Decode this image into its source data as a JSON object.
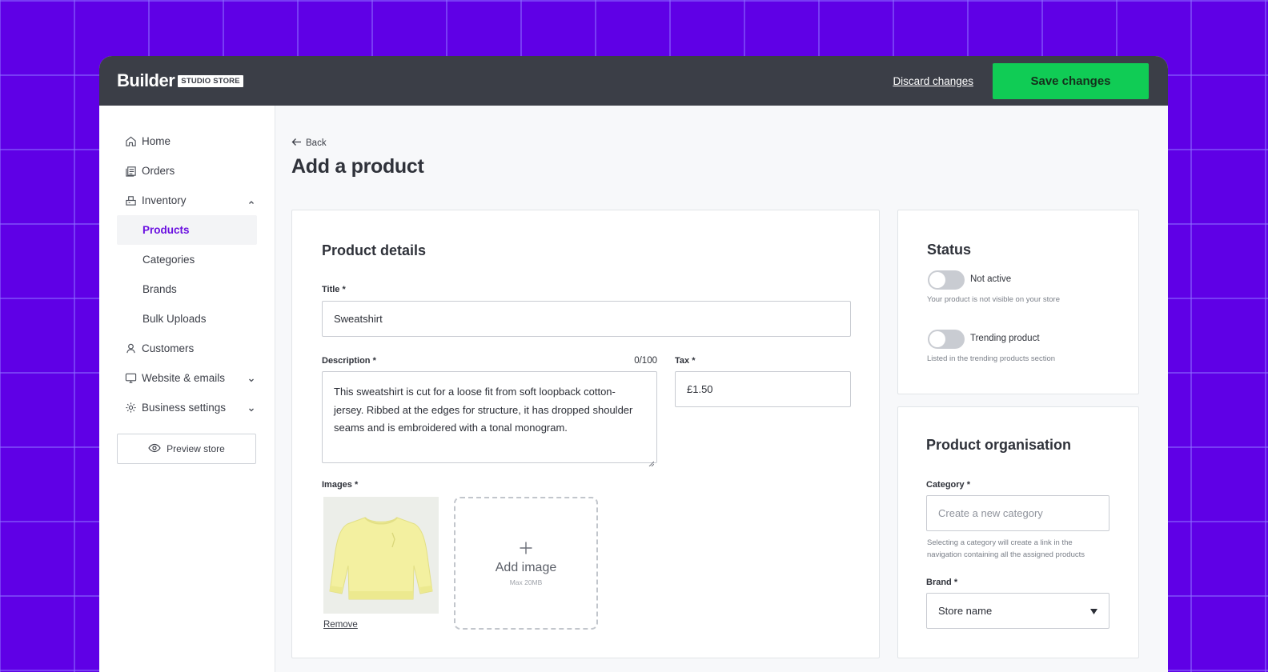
{
  "brand": {
    "logo_text": "Builder",
    "badge": "STUDIO STORE"
  },
  "topbar": {
    "discard_label": "Discard changes",
    "save_label": "Save changes"
  },
  "colors": {
    "accent": "#6a0fe0",
    "save_button": "#10cc55",
    "topbar": "#3b3e47",
    "background": "#5f00e6"
  },
  "sidebar": {
    "items": [
      {
        "label": "Home",
        "icon": "home-icon"
      },
      {
        "label": "Orders",
        "icon": "orders-icon"
      },
      {
        "label": "Inventory",
        "icon": "inventory-icon",
        "expanded": true
      },
      {
        "label": "Products",
        "active": true
      },
      {
        "label": "Categories"
      },
      {
        "label": "Brands"
      },
      {
        "label": "Bulk Uploads"
      },
      {
        "label": "Customers",
        "icon": "customers-icon"
      },
      {
        "label": "Website & emails",
        "icon": "monitor-icon",
        "expanded": false
      },
      {
        "label": "Business settings",
        "icon": "gear-icon",
        "expanded": false
      }
    ],
    "preview_label": "Preview store"
  },
  "page": {
    "back_label": "Back",
    "title": "Add a product"
  },
  "product_details": {
    "heading": "Product details",
    "title_label": "Title *",
    "title_value": "Sweatshirt",
    "description_label": "Description *",
    "description_count": "0/100",
    "description_value": "This sweatshirt is cut for a loose fit from soft loopback cotton-jersey. Ribbed at the edges for structure, it has dropped shoulder seams and is embroidered with a tonal monogram.",
    "tax_label": "Tax *",
    "tax_value": "£1.50",
    "images_label": "Images *",
    "remove_label": "Remove",
    "add_image_label": "Add image",
    "add_image_hint": "Max 20MB"
  },
  "status": {
    "heading": "Status",
    "toggles": [
      {
        "label": "Not active",
        "hint": "Your product is not visible on your store",
        "on": false
      },
      {
        "label": "Trending product",
        "hint": "Listed in the trending products section",
        "on": false
      }
    ]
  },
  "organisation": {
    "heading": "Product organisation",
    "category_label": "Category *",
    "category_placeholder": "Create a new category",
    "category_hint": "Selecting a category will create a link in the navigation containing all the assigned products",
    "brand_label": "Brand *",
    "brand_value": "Store name"
  }
}
